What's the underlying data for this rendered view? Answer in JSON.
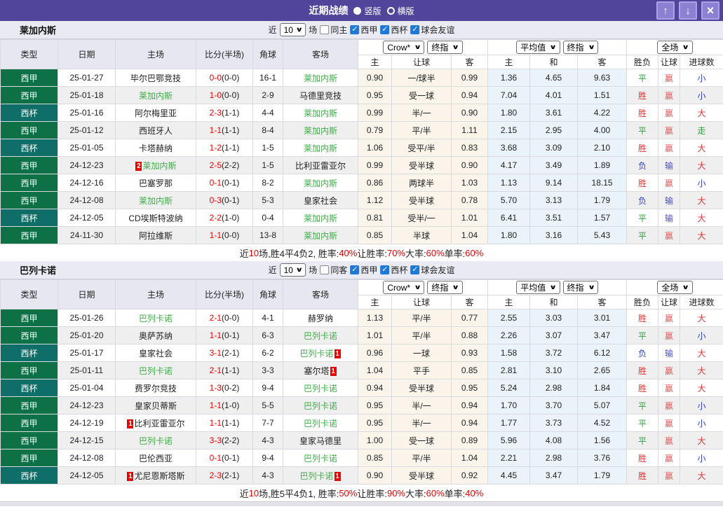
{
  "titlebar": {
    "title": "近期战绩",
    "vertical_label": "竖版",
    "horizontal_label": "横版"
  },
  "icons": {
    "check": "✓",
    "chevron_down": "∨",
    "up_arrow": "↑",
    "down_arrow": "↓",
    "close": "×"
  },
  "colors": {
    "titlebar": "#50459B",
    "window_button": "#8B80D2",
    "target_team_green": "#3DAE46",
    "score_red": "#E60000",
    "checkbox_blue": "#1E78D7",
    "odds_bg": "#FBF4EA",
    "euro_bg": "#EAF3FA"
  },
  "type_colors": {
    "西甲": "#0E7145",
    "西杯": "#0F6E68"
  },
  "result_colors": {
    "胜": "#E53333",
    "平": "#2E9E3E",
    "负": "#3340CC",
    "赢": "#E05A5A",
    "输": "#4A4AD4",
    "大": "#E53333",
    "小": "#3340CC",
    "走": "#2E9E3E"
  },
  "table": {
    "left_headers": [
      "类型",
      "日期",
      "主场",
      "比分(半场)",
      "角球",
      "客场"
    ],
    "right_headers": [
      "主",
      "让球",
      "客",
      "主",
      "和",
      "客",
      "胜负",
      "让球",
      "进球数"
    ],
    "controls": {
      "book": "Crow*",
      "book_time": "终指",
      "euro": "平均值",
      "euro_time": "终指",
      "scope": "全场"
    }
  },
  "sections": [
    {
      "team": "莱加内斯",
      "filter": {
        "near_label": "近",
        "count": "10",
        "games_label": "场",
        "same_label": "同主",
        "leagues": [
          "西甲",
          "西杯",
          "球会友谊"
        ]
      },
      "rows": [
        {
          "type": "西甲",
          "date": "25-01-27",
          "home": "毕尔巴鄂竞技",
          "home_card": 0,
          "score_ft": "0-0",
          "score_ht": "(0-0)",
          "corner": "16-1",
          "away": "莱加内斯",
          "away_card": 0,
          "odds": [
            "0.90",
            "一/球半",
            "0.99"
          ],
          "euro": [
            "1.36",
            "4.65",
            "9.63"
          ],
          "results": [
            "平",
            "赢",
            "小"
          ]
        },
        {
          "type": "西甲",
          "date": "25-01-18",
          "home": "莱加内斯",
          "home_card": 0,
          "score_ft": "1-0",
          "score_ht": "(0-0)",
          "corner": "2-9",
          "away": "马德里竞技",
          "away_card": 0,
          "odds": [
            "0.95",
            "受一球",
            "0.94"
          ],
          "euro": [
            "7.04",
            "4.01",
            "1.51"
          ],
          "results": [
            "胜",
            "赢",
            "小"
          ]
        },
        {
          "type": "西杯",
          "date": "25-01-16",
          "home": "阿尔梅里亚",
          "home_card": 0,
          "score_ft": "2-3",
          "score_ht": "(1-1)",
          "corner": "4-4",
          "away": "莱加内斯",
          "away_card": 0,
          "odds": [
            "0.99",
            "半/一",
            "0.90"
          ],
          "euro": [
            "1.80",
            "3.61",
            "4.22"
          ],
          "results": [
            "胜",
            "赢",
            "大"
          ]
        },
        {
          "type": "西甲",
          "date": "25-01-12",
          "home": "西班牙人",
          "home_card": 0,
          "score_ft": "1-1",
          "score_ht": "(1-1)",
          "corner": "8-4",
          "away": "莱加内斯",
          "away_card": 0,
          "odds": [
            "0.79",
            "平/半",
            "1.11"
          ],
          "euro": [
            "2.15",
            "2.95",
            "4.00"
          ],
          "results": [
            "平",
            "赢",
            "走"
          ]
        },
        {
          "type": "西杯",
          "date": "25-01-05",
          "home": "卡塔赫纳",
          "home_card": 0,
          "score_ft": "1-2",
          "score_ht": "(1-1)",
          "corner": "1-5",
          "away": "莱加内斯",
          "away_card": 0,
          "odds": [
            "1.06",
            "受平/半",
            "0.83"
          ],
          "euro": [
            "3.68",
            "3.09",
            "2.10"
          ],
          "results": [
            "胜",
            "赢",
            "大"
          ]
        },
        {
          "type": "西甲",
          "date": "24-12-23",
          "home": "莱加内斯",
          "home_card": 2,
          "score_ft": "2-5",
          "score_ht": "(2-2)",
          "corner": "1-5",
          "away": "比利亚雷亚尔",
          "away_card": 0,
          "odds": [
            "0.99",
            "受半球",
            "0.90"
          ],
          "euro": [
            "4.17",
            "3.49",
            "1.89"
          ],
          "results": [
            "负",
            "输",
            "大"
          ]
        },
        {
          "type": "西甲",
          "date": "24-12-16",
          "home": "巴塞罗那",
          "home_card": 0,
          "score_ft": "0-1",
          "score_ht": "(0-1)",
          "corner": "8-2",
          "away": "莱加内斯",
          "away_card": 0,
          "odds": [
            "0.86",
            "两球半",
            "1.03"
          ],
          "euro": [
            "1.13",
            "9.14",
            "18.15"
          ],
          "results": [
            "胜",
            "赢",
            "小"
          ]
        },
        {
          "type": "西甲",
          "date": "24-12-08",
          "home": "莱加内斯",
          "home_card": 0,
          "score_ft": "0-3",
          "score_ht": "(0-1)",
          "corner": "5-3",
          "away": "皇家社会",
          "away_card": 0,
          "odds": [
            "1.12",
            "受半球",
            "0.78"
          ],
          "euro": [
            "5.70",
            "3.13",
            "1.79"
          ],
          "results": [
            "负",
            "输",
            "大"
          ]
        },
        {
          "type": "西杯",
          "date": "24-12-05",
          "home": "CD埃斯特波纳",
          "home_card": 0,
          "score_ft": "2-2",
          "score_ht": "(1-0)",
          "corner": "0-4",
          "away": "莱加内斯",
          "away_card": 0,
          "odds": [
            "0.81",
            "受半/一",
            "1.01"
          ],
          "euro": [
            "6.41",
            "3.51",
            "1.57"
          ],
          "results": [
            "平",
            "输",
            "大"
          ]
        },
        {
          "type": "西甲",
          "date": "24-11-30",
          "home": "阿拉维斯",
          "home_card": 0,
          "score_ft": "1-1",
          "score_ht": "(0-0)",
          "corner": "13-8",
          "away": "莱加内斯",
          "away_card": 0,
          "odds": [
            "0.85",
            "半球",
            "1.04"
          ],
          "euro": [
            "1.80",
            "3.16",
            "5.43"
          ],
          "results": [
            "平",
            "赢",
            "大"
          ]
        }
      ],
      "summary": [
        {
          "t": "近",
          "r": false
        },
        {
          "t": "10",
          "r": true
        },
        {
          "t": "场,胜4平4负2, 胜率:",
          "r": false
        },
        {
          "t": "40%",
          "r": true
        },
        {
          "t": " 让胜率:",
          "r": false
        },
        {
          "t": "70%",
          "r": true
        },
        {
          "t": " 大率:",
          "r": false
        },
        {
          "t": "60%",
          "r": true
        },
        {
          "t": " 单率:",
          "r": false
        },
        {
          "t": "60%",
          "r": true
        }
      ]
    },
    {
      "team": "巴列卡诺",
      "filter": {
        "near_label": "近",
        "count": "10",
        "games_label": "场",
        "same_label": "同客",
        "leagues": [
          "西甲",
          "西杯",
          "球会友谊"
        ]
      },
      "rows": [
        {
          "type": "西甲",
          "date": "25-01-26",
          "home": "巴列卡诺",
          "home_card": 0,
          "score_ft": "2-1",
          "score_ht": "(0-0)",
          "corner": "4-1",
          "away": "赫罗纳",
          "away_card": 0,
          "odds": [
            "1.13",
            "平/半",
            "0.77"
          ],
          "euro": [
            "2.55",
            "3.03",
            "3.01"
          ],
          "results": [
            "胜",
            "赢",
            "大"
          ]
        },
        {
          "type": "西甲",
          "date": "25-01-20",
          "home": "奥萨苏纳",
          "home_card": 0,
          "score_ft": "1-1",
          "score_ht": "(0-1)",
          "corner": "6-3",
          "away": "巴列卡诺",
          "away_card": 0,
          "odds": [
            "1.01",
            "平/半",
            "0.88"
          ],
          "euro": [
            "2.26",
            "3.07",
            "3.47"
          ],
          "results": [
            "平",
            "赢",
            "小"
          ]
        },
        {
          "type": "西杯",
          "date": "25-01-17",
          "home": "皇家社会",
          "home_card": 0,
          "score_ft": "3-1",
          "score_ht": "(2-1)",
          "corner": "6-2",
          "away": "巴列卡诺",
          "away_card": 1,
          "odds": [
            "0.96",
            "一球",
            "0.93"
          ],
          "euro": [
            "1.58",
            "3.72",
            "6.12"
          ],
          "results": [
            "负",
            "输",
            "大"
          ]
        },
        {
          "type": "西甲",
          "date": "25-01-11",
          "home": "巴列卡诺",
          "home_card": 0,
          "score_ft": "2-1",
          "score_ht": "(1-1)",
          "corner": "3-3",
          "away": "塞尔塔",
          "away_card": 1,
          "odds": [
            "1.04",
            "平手",
            "0.85"
          ],
          "euro": [
            "2.81",
            "3.10",
            "2.65"
          ],
          "results": [
            "胜",
            "赢",
            "大"
          ]
        },
        {
          "type": "西杯",
          "date": "25-01-04",
          "home": "费罗尔竞技",
          "home_card": 0,
          "score_ft": "1-3",
          "score_ht": "(0-2)",
          "corner": "9-4",
          "away": "巴列卡诺",
          "away_card": 0,
          "odds": [
            "0.94",
            "受半球",
            "0.95"
          ],
          "euro": [
            "5.24",
            "2.98",
            "1.84"
          ],
          "results": [
            "胜",
            "赢",
            "大"
          ]
        },
        {
          "type": "西甲",
          "date": "24-12-23",
          "home": "皇家贝蒂斯",
          "home_card": 0,
          "score_ft": "1-1",
          "score_ht": "(1-0)",
          "corner": "5-5",
          "away": "巴列卡诺",
          "away_card": 0,
          "odds": [
            "0.95",
            "半/一",
            "0.94"
          ],
          "euro": [
            "1.70",
            "3.70",
            "5.07"
          ],
          "results": [
            "平",
            "赢",
            "小"
          ]
        },
        {
          "type": "西甲",
          "date": "24-12-19",
          "home": "比利亚雷亚尔",
          "home_card": 1,
          "score_ft": "1-1",
          "score_ht": "(1-1)",
          "corner": "7-7",
          "away": "巴列卡诺",
          "away_card": 0,
          "odds": [
            "0.95",
            "半/一",
            "0.94"
          ],
          "euro": [
            "1.77",
            "3.73",
            "4.52"
          ],
          "results": [
            "平",
            "赢",
            "小"
          ]
        },
        {
          "type": "西甲",
          "date": "24-12-15",
          "home": "巴列卡诺",
          "home_card": 0,
          "score_ft": "3-3",
          "score_ht": "(2-2)",
          "corner": "4-3",
          "away": "皇家马德里",
          "away_card": 0,
          "odds": [
            "1.00",
            "受一球",
            "0.89"
          ],
          "euro": [
            "5.96",
            "4.08",
            "1.56"
          ],
          "results": [
            "平",
            "赢",
            "大"
          ]
        },
        {
          "type": "西甲",
          "date": "24-12-08",
          "home": "巴伦西亚",
          "home_card": 0,
          "score_ft": "0-1",
          "score_ht": "(0-1)",
          "corner": "9-4",
          "away": "巴列卡诺",
          "away_card": 0,
          "odds": [
            "0.85",
            "平/半",
            "1.04"
          ],
          "euro": [
            "2.21",
            "2.98",
            "3.76"
          ],
          "results": [
            "胜",
            "赢",
            "小"
          ]
        },
        {
          "type": "西杯",
          "date": "24-12-05",
          "home": "尤尼恩斯塔斯",
          "home_card": 1,
          "score_ft": "2-3",
          "score_ht": "(2-1)",
          "corner": "4-3",
          "away": "巴列卡诺",
          "away_card": 1,
          "odds": [
            "0.90",
            "受半球",
            "0.92"
          ],
          "euro": [
            "4.45",
            "3.47",
            "1.79"
          ],
          "results": [
            "胜",
            "赢",
            "大"
          ]
        }
      ],
      "summary": [
        {
          "t": "近",
          "r": false
        },
        {
          "t": "10",
          "r": true
        },
        {
          "t": "场,胜5平4负1, 胜率:",
          "r": false
        },
        {
          "t": "50%",
          "r": true
        },
        {
          "t": " 让胜率:",
          "r": false
        },
        {
          "t": "90%",
          "r": true
        },
        {
          "t": " 大率:",
          "r": false
        },
        {
          "t": "60%",
          "r": true
        },
        {
          "t": " 单率:",
          "r": false
        },
        {
          "t": "40%",
          "r": true
        }
      ]
    }
  ]
}
